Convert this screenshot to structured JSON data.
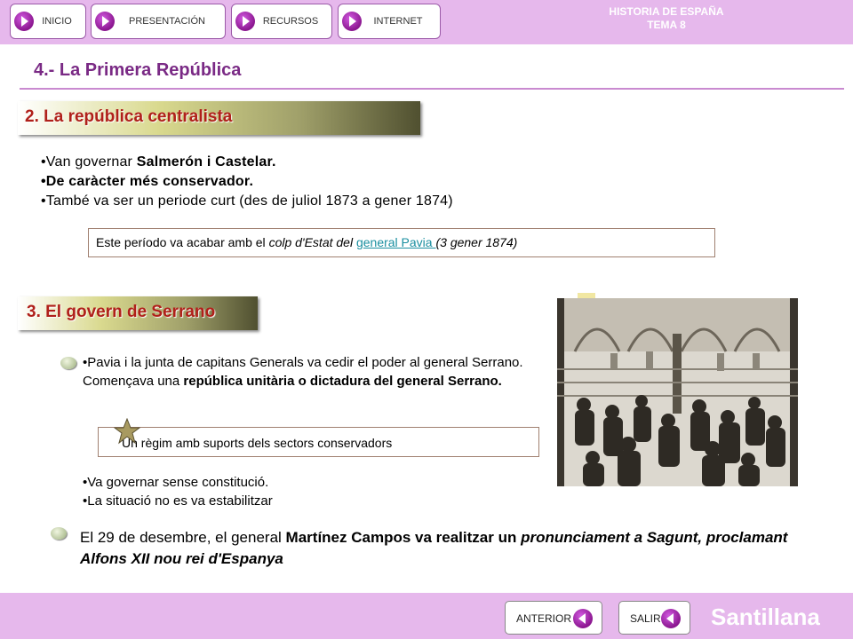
{
  "header": {
    "nav": [
      "INICIO",
      "PRESENTACIÓN",
      "RECURSOS",
      "INTERNET"
    ],
    "title_line1": "HISTORIA DE ESPAÑA",
    "title_line2": "TEMA 8"
  },
  "page": {
    "title": "4.- La Primera República"
  },
  "section1": {
    "heading": "2. La república centralista",
    "line1_prefix": "•Van governar  ",
    "line1_bold": "Salmerón i Castelar.",
    "line2": "•De caràcter més conservador.",
    "line3": "•També va ser un periode curt (des de juliol 1873 a gener 1874)",
    "box_prefix": "Este período va acabar amb el ",
    "box_italic": "colp d'Estat del ",
    "box_link": "general Pavia ",
    "box_suffix": "(3 gener 1874)"
  },
  "section2": {
    "heading": "3. El govern de Serrano",
    "para1_normal": "•Pavia  i la junta de capitans Generals va  cedir el poder al general Serrano. Començava una ",
    "para1_bold": "república unitària o dictadura del general Serrano.",
    "box": "Un règim amb suports dels sectors conservadors",
    "line_a": "•Va governar sense constitució.",
    "line_b": "•La situació no es va estabilitzar",
    "final_prefix": "El 29 de desembre, el general ",
    "final_bold": "Martínez Campos va realitzar un ",
    "final_bold_italic1": "pronunciament a Sagunt, ",
    "final_bold_italic2": "proclamant Alfons XII nou rei d'Espanya"
  },
  "footer": {
    "prev": "ANTERIOR",
    "exit": "SALIR",
    "brand": "Santillana"
  },
  "colors": {
    "header_bg": "#e6b8ec",
    "title": "#7a2a85",
    "section_heading": "#b0201a",
    "link": "#1a8fa0"
  },
  "icons": [
    "arrow-icon",
    "bullet-circle-icon",
    "star-icon",
    "back-arrow-icon"
  ]
}
